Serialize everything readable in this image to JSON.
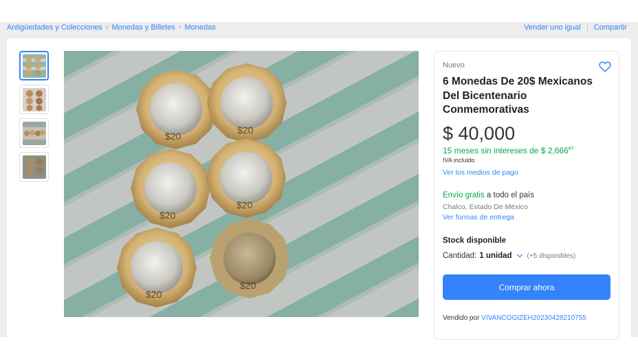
{
  "breadcrumb": {
    "items": [
      "Antigüedades y Colecciones",
      "Monedas y Billetes",
      "Monedas"
    ],
    "separator": "›"
  },
  "top_links": {
    "sell_same": "Vender uno igual",
    "share": "Compartir"
  },
  "product": {
    "condition": "Nuevo",
    "title": "6 Monedas De 20$ Mexicanos Del Bicentenario Conmemorativas",
    "price": "$ 40,000",
    "installments_text": "15 meses sin intereses de $ 2,666",
    "installments_cents": "67",
    "iva": "IVA incluido",
    "payment_link": "Ver los medios de pago",
    "shipping_free": "Envío gratis",
    "shipping_rest": " a todo el país",
    "location": "Chalco, Estado De México",
    "delivery_link": "Ver formas de entrega",
    "stock": "Stock disponible",
    "quantity_label": "Cantidad:",
    "quantity_value": "1 unidad",
    "available": "(+5 disponibles)",
    "buy_button": "Comprar ahora",
    "sold_by_label": "Vendido por",
    "seller": "VIVANCOGIZEH20230428210755"
  },
  "colors": {
    "accent": "#3483fa",
    "green": "#00a650",
    "background": "#ededed"
  },
  "icons": {
    "favorite": "heart-icon",
    "dropdown": "chevron-down-icon"
  }
}
